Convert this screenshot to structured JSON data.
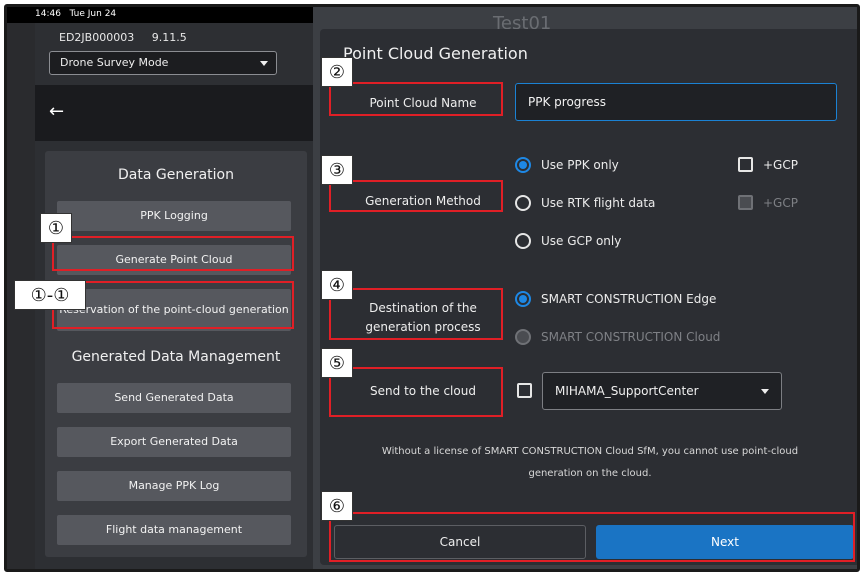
{
  "status_bar": {
    "time": "14:46",
    "date": "Tue Jun 24"
  },
  "device": {
    "id": "ED2JB000003",
    "version": "9.11.5"
  },
  "mode_select": {
    "value": "Drone Survey Mode"
  },
  "background_title": "Test01",
  "left_panel": {
    "data_generation_heading": "Data Generation",
    "buttons_generation": [
      "PPK Logging",
      "Generate Point Cloud",
      "Reservation of the point-cloud generation"
    ],
    "management_heading": "Generated Data Management",
    "buttons_management": [
      "Send Generated Data",
      "Export Generated Data",
      "Manage PPK Log",
      "Flight data management"
    ]
  },
  "dialog": {
    "title": "Point Cloud Generation",
    "point_cloud_name": {
      "label": "Point Cloud Name",
      "value": "PPK progress"
    },
    "generation_method": {
      "label": "Generation Method",
      "options": [
        "Use PPK only",
        "Use RTK flight data",
        "Use GCP only"
      ],
      "selected": "Use PPK only",
      "gcp_label": "+GCP"
    },
    "destination": {
      "label": "Destination of the generation process",
      "options": [
        "SMART CONSTRUCTION Edge",
        "SMART CONSTRUCTION Cloud"
      ],
      "selected": "SMART CONSTRUCTION Edge"
    },
    "send_to_cloud": {
      "label": "Send to the cloud",
      "selected_center": "MIHAMA_SupportCenter"
    },
    "notice": "Without a license of SMART CONSTRUCTION Cloud SfM, you cannot use point-cloud generation on the cloud.",
    "cancel_label": "Cancel",
    "next_label": "Next"
  },
  "annotations": [
    "①",
    "①-①",
    "②",
    "③",
    "④",
    "⑤",
    "⑥"
  ],
  "colors": {
    "accent": "#1e88e5",
    "annotation": "#e01f26",
    "next_button": "#1a74c4"
  }
}
